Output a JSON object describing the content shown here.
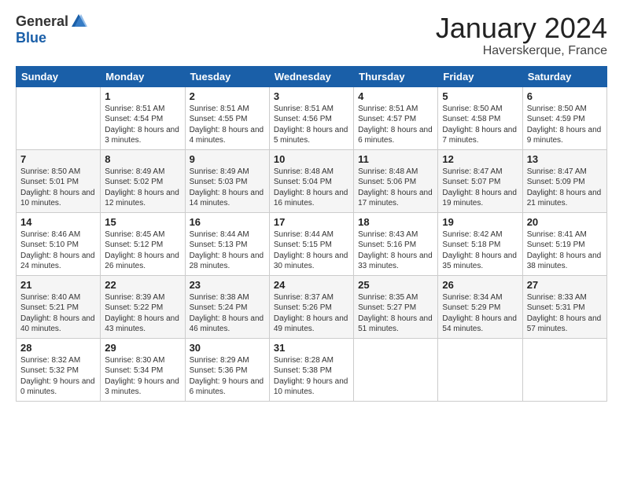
{
  "header": {
    "logo_general": "General",
    "logo_blue": "Blue",
    "month_title": "January 2024",
    "location": "Haverskerque, France"
  },
  "weekdays": [
    "Sunday",
    "Monday",
    "Tuesday",
    "Wednesday",
    "Thursday",
    "Friday",
    "Saturday"
  ],
  "weeks": [
    [
      {
        "day": "",
        "sunrise": "",
        "sunset": "",
        "daylight": ""
      },
      {
        "day": "1",
        "sunrise": "Sunrise: 8:51 AM",
        "sunset": "Sunset: 4:54 PM",
        "daylight": "Daylight: 8 hours and 3 minutes."
      },
      {
        "day": "2",
        "sunrise": "Sunrise: 8:51 AM",
        "sunset": "Sunset: 4:55 PM",
        "daylight": "Daylight: 8 hours and 4 minutes."
      },
      {
        "day": "3",
        "sunrise": "Sunrise: 8:51 AM",
        "sunset": "Sunset: 4:56 PM",
        "daylight": "Daylight: 8 hours and 5 minutes."
      },
      {
        "day": "4",
        "sunrise": "Sunrise: 8:51 AM",
        "sunset": "Sunset: 4:57 PM",
        "daylight": "Daylight: 8 hours and 6 minutes."
      },
      {
        "day": "5",
        "sunrise": "Sunrise: 8:50 AM",
        "sunset": "Sunset: 4:58 PM",
        "daylight": "Daylight: 8 hours and 7 minutes."
      },
      {
        "day": "6",
        "sunrise": "Sunrise: 8:50 AM",
        "sunset": "Sunset: 4:59 PM",
        "daylight": "Daylight: 8 hours and 9 minutes."
      }
    ],
    [
      {
        "day": "7",
        "sunrise": "Sunrise: 8:50 AM",
        "sunset": "Sunset: 5:01 PM",
        "daylight": "Daylight: 8 hours and 10 minutes."
      },
      {
        "day": "8",
        "sunrise": "Sunrise: 8:49 AM",
        "sunset": "Sunset: 5:02 PM",
        "daylight": "Daylight: 8 hours and 12 minutes."
      },
      {
        "day": "9",
        "sunrise": "Sunrise: 8:49 AM",
        "sunset": "Sunset: 5:03 PM",
        "daylight": "Daylight: 8 hours and 14 minutes."
      },
      {
        "day": "10",
        "sunrise": "Sunrise: 8:48 AM",
        "sunset": "Sunset: 5:04 PM",
        "daylight": "Daylight: 8 hours and 16 minutes."
      },
      {
        "day": "11",
        "sunrise": "Sunrise: 8:48 AM",
        "sunset": "Sunset: 5:06 PM",
        "daylight": "Daylight: 8 hours and 17 minutes."
      },
      {
        "day": "12",
        "sunrise": "Sunrise: 8:47 AM",
        "sunset": "Sunset: 5:07 PM",
        "daylight": "Daylight: 8 hours and 19 minutes."
      },
      {
        "day": "13",
        "sunrise": "Sunrise: 8:47 AM",
        "sunset": "Sunset: 5:09 PM",
        "daylight": "Daylight: 8 hours and 21 minutes."
      }
    ],
    [
      {
        "day": "14",
        "sunrise": "Sunrise: 8:46 AM",
        "sunset": "Sunset: 5:10 PM",
        "daylight": "Daylight: 8 hours and 24 minutes."
      },
      {
        "day": "15",
        "sunrise": "Sunrise: 8:45 AM",
        "sunset": "Sunset: 5:12 PM",
        "daylight": "Daylight: 8 hours and 26 minutes."
      },
      {
        "day": "16",
        "sunrise": "Sunrise: 8:44 AM",
        "sunset": "Sunset: 5:13 PM",
        "daylight": "Daylight: 8 hours and 28 minutes."
      },
      {
        "day": "17",
        "sunrise": "Sunrise: 8:44 AM",
        "sunset": "Sunset: 5:15 PM",
        "daylight": "Daylight: 8 hours and 30 minutes."
      },
      {
        "day": "18",
        "sunrise": "Sunrise: 8:43 AM",
        "sunset": "Sunset: 5:16 PM",
        "daylight": "Daylight: 8 hours and 33 minutes."
      },
      {
        "day": "19",
        "sunrise": "Sunrise: 8:42 AM",
        "sunset": "Sunset: 5:18 PM",
        "daylight": "Daylight: 8 hours and 35 minutes."
      },
      {
        "day": "20",
        "sunrise": "Sunrise: 8:41 AM",
        "sunset": "Sunset: 5:19 PM",
        "daylight": "Daylight: 8 hours and 38 minutes."
      }
    ],
    [
      {
        "day": "21",
        "sunrise": "Sunrise: 8:40 AM",
        "sunset": "Sunset: 5:21 PM",
        "daylight": "Daylight: 8 hours and 40 minutes."
      },
      {
        "day": "22",
        "sunrise": "Sunrise: 8:39 AM",
        "sunset": "Sunset: 5:22 PM",
        "daylight": "Daylight: 8 hours and 43 minutes."
      },
      {
        "day": "23",
        "sunrise": "Sunrise: 8:38 AM",
        "sunset": "Sunset: 5:24 PM",
        "daylight": "Daylight: 8 hours and 46 minutes."
      },
      {
        "day": "24",
        "sunrise": "Sunrise: 8:37 AM",
        "sunset": "Sunset: 5:26 PM",
        "daylight": "Daylight: 8 hours and 49 minutes."
      },
      {
        "day": "25",
        "sunrise": "Sunrise: 8:35 AM",
        "sunset": "Sunset: 5:27 PM",
        "daylight": "Daylight: 8 hours and 51 minutes."
      },
      {
        "day": "26",
        "sunrise": "Sunrise: 8:34 AM",
        "sunset": "Sunset: 5:29 PM",
        "daylight": "Daylight: 8 hours and 54 minutes."
      },
      {
        "day": "27",
        "sunrise": "Sunrise: 8:33 AM",
        "sunset": "Sunset: 5:31 PM",
        "daylight": "Daylight: 8 hours and 57 minutes."
      }
    ],
    [
      {
        "day": "28",
        "sunrise": "Sunrise: 8:32 AM",
        "sunset": "Sunset: 5:32 PM",
        "daylight": "Daylight: 9 hours and 0 minutes."
      },
      {
        "day": "29",
        "sunrise": "Sunrise: 8:30 AM",
        "sunset": "Sunset: 5:34 PM",
        "daylight": "Daylight: 9 hours and 3 minutes."
      },
      {
        "day": "30",
        "sunrise": "Sunrise: 8:29 AM",
        "sunset": "Sunset: 5:36 PM",
        "daylight": "Daylight: 9 hours and 6 minutes."
      },
      {
        "day": "31",
        "sunrise": "Sunrise: 8:28 AM",
        "sunset": "Sunset: 5:38 PM",
        "daylight": "Daylight: 9 hours and 10 minutes."
      },
      {
        "day": "",
        "sunrise": "",
        "sunset": "",
        "daylight": ""
      },
      {
        "day": "",
        "sunrise": "",
        "sunset": "",
        "daylight": ""
      },
      {
        "day": "",
        "sunrise": "",
        "sunset": "",
        "daylight": ""
      }
    ]
  ]
}
